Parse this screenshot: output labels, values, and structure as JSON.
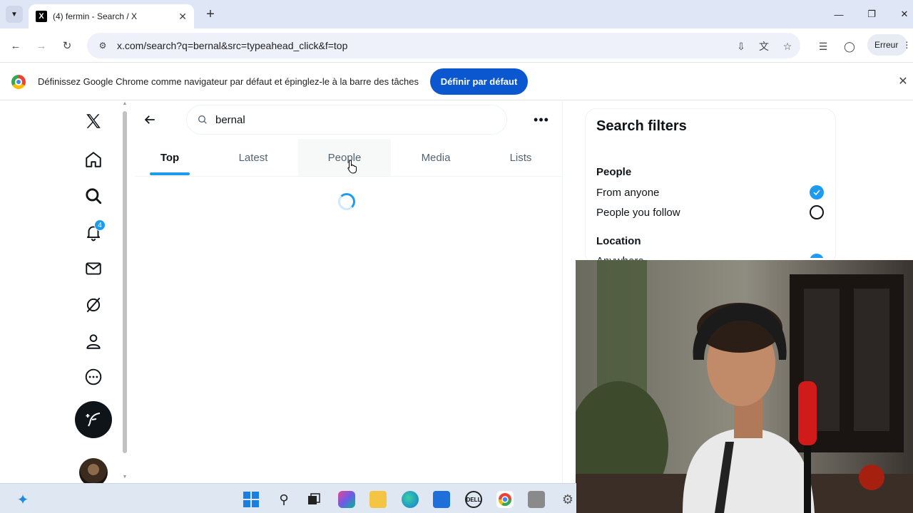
{
  "browser": {
    "tab_title": "(4) fermin - Search / X",
    "tab_favicon": "X",
    "address": "x.com/search?q=bernal&src=typeahead_click&f=top",
    "profile_label": "Erreur"
  },
  "infobar": {
    "message": "Définissez Google Chrome comme navigateur par défaut et épinglez-le à la barre des tâches",
    "button_label": "Définir par défaut"
  },
  "sidebar": {
    "notification_count": "4",
    "icons": [
      "x-logo-icon",
      "home-icon",
      "explore-icon",
      "notifications-icon",
      "messages-icon",
      "grok-icon",
      "profile-icon",
      "more-icon",
      "post-icon"
    ]
  },
  "search": {
    "query": "bernal"
  },
  "tabs": [
    {
      "label": "Top",
      "active": true
    },
    {
      "label": "Latest",
      "active": false
    },
    {
      "label": "People",
      "active": false
    },
    {
      "label": "Media",
      "active": false
    },
    {
      "label": "Lists",
      "active": false
    }
  ],
  "filters": {
    "title": "Search filters",
    "people_heading": "People",
    "from_anyone": "From anyone",
    "people_you_follow": "People you follow",
    "location_heading": "Location",
    "anywhere": "Anywhere"
  },
  "colors": {
    "accent": "#1d9bf0",
    "chrome_button": "#0b57d0",
    "text": "#0f1419",
    "secondary_text": "#536471"
  }
}
